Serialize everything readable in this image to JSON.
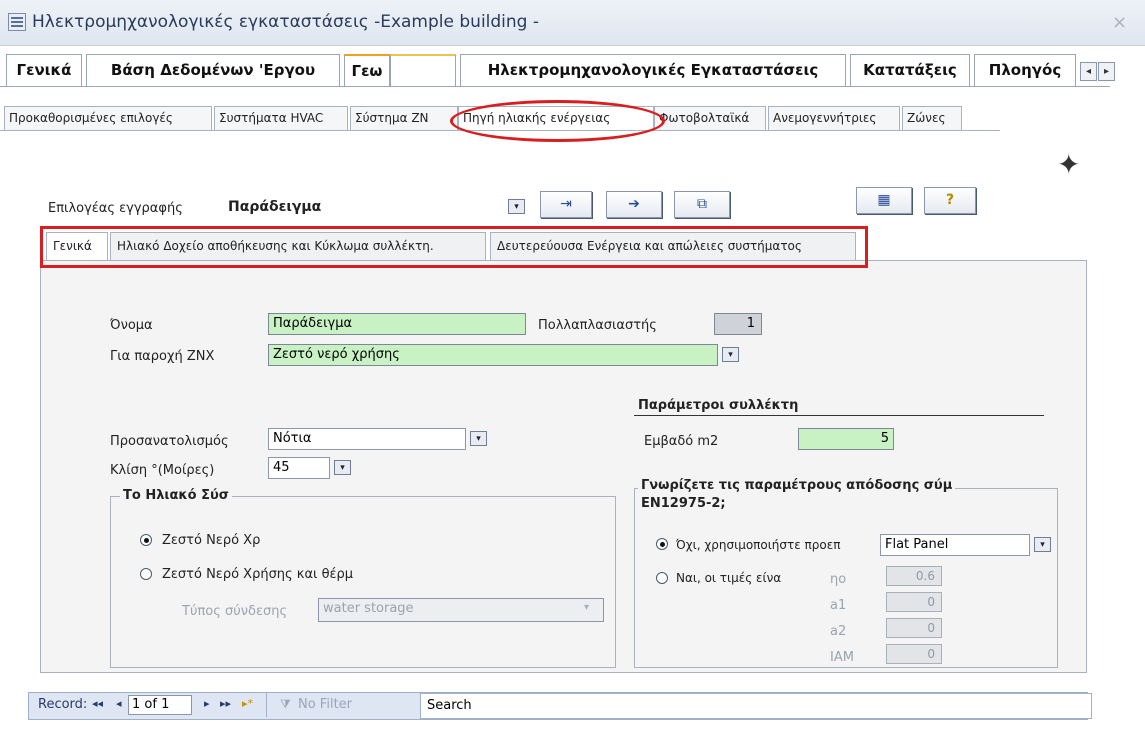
{
  "window": {
    "title": "Ηλεκτρομηχανολογικές εγκαταστάσεις -Example building -",
    "close": "×"
  },
  "main_tabs": [
    "Γενικά",
    "Βάση Δεδομένων 'Εργου",
    "Γεω",
    "",
    "Ηλεκτρομηχανολογικές Εγκαταστάσεις",
    "Κατατάξεις",
    "Πλοηγός"
  ],
  "main_tabs_scroll": {
    "left": "◂",
    "right": "▸"
  },
  "sub_tabs": [
    "Προκαθορισμένες επιλογές",
    "Συστήματα HVAC",
    "Σύστημα ΖΝ",
    "Πηγή ηλιακής ενέργειας",
    "Φωτοβολταϊκά",
    "Ανεμογεννήτριες",
    "Ζώνες"
  ],
  "record_select": {
    "label": "Επιλογέας εγγραφής",
    "value": "Παράδειγμα",
    "arrow": "▾"
  },
  "toolbar": {
    "btn1": "⇥",
    "btn2": "➔",
    "btn3": "⧉",
    "btn4": "▦",
    "btn5": "?"
  },
  "inner_tabs": [
    "Γενικά",
    "Ηλιακό Δοχείο αποθήκευσης και Κύκλωμα συλλέκτη.",
    "Δευτερεύουσα Ενέργεια και απώλειες συστήματος"
  ],
  "form": {
    "name_label": "Όνομα",
    "name_value": "Παράδειγμα",
    "multiplier_label": "Πολλαπλασιαστής",
    "multiplier_value": "1",
    "dhw_label": "Για παροχή ΖΝΧ",
    "dhw_value": "Ζεστό νερό χρήσης",
    "orientation_label": "Προσανατολισμός",
    "orientation_value": "Νότια",
    "tilt_label": "Κλίση   °(Μοίρες)",
    "tilt_value": "45",
    "collector_params_title": "Παράμετροι συλλέκτη",
    "area_label": "Εμβαδό   m2",
    "area_value": "5"
  },
  "solar_group": {
    "title": "Το Ηλιακό Σύσ",
    "opt1": "Ζεστό Νερό Χρ",
    "opt2": "Ζεστό Νερό Χρήσης και θέρμ",
    "connection_label": "Τύπος σύνδεσης",
    "connection_value": "water storage"
  },
  "efficiency_group": {
    "title_line1": "Γνωρίζετε τις παραμέτρους απόδοσης σύμ",
    "title_line2": "EN12975-2;",
    "opt_no": "Όχι, χρησιμοποιήστε προεπ",
    "opt_no_value": "Flat Panel",
    "opt_yes": "Ναι, οι τιμές είνα",
    "params": [
      {
        "label": "ηο",
        "value": "0.6"
      },
      {
        "label": "a1",
        "value": "0"
      },
      {
        "label": "a2",
        "value": "0"
      },
      {
        "label": "IAM",
        "value": "0"
      }
    ]
  },
  "record_nav": {
    "label": "Record:",
    "first": "◂◂",
    "prev": "◂",
    "position": "1 of 1",
    "next": "▸",
    "last": "▸▸",
    "new": "▸*",
    "filter": "No Filter",
    "search": "Search"
  },
  "colors": {
    "highlight_red": "#d81e1e",
    "field_green": "#c8f2c4",
    "tab_accent": "#f0a020"
  }
}
